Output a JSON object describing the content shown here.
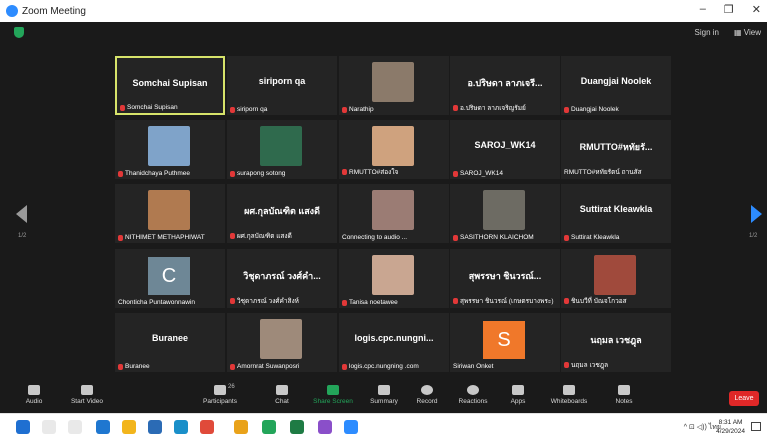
{
  "window": {
    "title": "Zoom Meeting",
    "minimize": "–",
    "maximize": "❐",
    "close": "✕"
  },
  "topbar": {
    "sign_in": "Sign in",
    "view": "View"
  },
  "pager": {
    "left": "1/2",
    "right": "1/2"
  },
  "tiles": [
    {
      "big": "Somchai Supisan",
      "cap": "Somchai Supisan",
      "muted": true,
      "active": true
    },
    {
      "big": "siriporn qa",
      "cap": "siriporn qa",
      "muted": true
    },
    {
      "big": "",
      "cap": "Narathip",
      "muted": true,
      "photo": "#8b7a6a"
    },
    {
      "big": "อ.ปริษดา ลาภเจรี...",
      "cap": "อ.ปริษดา ลาภเจริญรัมย์",
      "muted": true
    },
    {
      "big": "Duangjai Noolek",
      "cap": "Duangjai Noolek",
      "muted": true
    },
    {
      "big": "",
      "cap": "Thanidchaya Puthmee",
      "muted": true,
      "photo": "#7fa3c9"
    },
    {
      "big": "",
      "cap": "surapong sotong",
      "muted": true,
      "photo": "#2f6a4d"
    },
    {
      "big": "",
      "cap": "RMUTTO#ส่องใจ",
      "muted": true,
      "photo": "#cfa27e"
    },
    {
      "big": "SAROJ_WK14",
      "cap": "SAROJ_WK14",
      "muted": true
    },
    {
      "big": "RMUTTO#หทัยรั...",
      "cap": "RMUTTO#หทัยรัตน์ ถานสัส",
      "muted": false
    },
    {
      "big": "",
      "cap": "NITHIMET METHAPHIWAT",
      "muted": true,
      "photo": "#b07a50"
    },
    {
      "big": "ผศ.กุลบัณฑิต แสงดี",
      "cap": "ผศ.กุลบัณฑิต แสงดี",
      "muted": true
    },
    {
      "big": "",
      "cap": "Connecting to audio ...",
      "muted": false,
      "photo": "#9b7c74"
    },
    {
      "big": "",
      "cap": "SASITHORN KLAICHOM",
      "muted": true,
      "photo": "#6d6b63"
    },
    {
      "big": "Suttirat Kleawkla",
      "cap": "Suttirat Kleawkla",
      "muted": true
    },
    {
      "big": "",
      "cap": "Chonticha Puntawonnawin",
      "muted": false,
      "letter": "C",
      "letter_bg": "#6e8796"
    },
    {
      "big": "วิชุดาภรณ์ วงศ์คำ...",
      "cap": "วิชุดาภรณ์ วงศ์คำสิงห์",
      "muted": true
    },
    {
      "big": "",
      "cap": "Tanisa noetawee",
      "muted": true,
      "photo": "#c9a691"
    },
    {
      "big": "สุพรรษา ชินวรณ์...",
      "cap": "สุพรรษา ชินวรณ์ (เกษตรบางพระ)",
      "muted": true
    },
    {
      "big": "",
      "cap": "ชินบวีที่ บัณจโกวอส",
      "muted": true,
      "photo": "#a04a3c"
    },
    {
      "big": "Buranee",
      "cap": "Buranee",
      "muted": true
    },
    {
      "big": "",
      "cap": "Amornrat Suwanposri",
      "muted": true,
      "photo": "#9e8a7a"
    },
    {
      "big": "logis.cpc.nungni...",
      "cap": "logis.cpc.nungning .com",
      "muted": true
    },
    {
      "big": "",
      "cap": "Siriwan Onket",
      "muted": false,
      "letter": "S",
      "letter_bg": "#f0782a"
    },
    {
      "big": "นฤมล เวชฎุล",
      "cap": "นฤมล เวชฎุล",
      "muted": true
    }
  ],
  "toolbar": {
    "audio": "Audio",
    "video": "Start Video",
    "participants": "Participants",
    "participants_count": "26",
    "chat": "Chat",
    "share": "Share Screen",
    "summary": "Summary",
    "record": "Record",
    "reactions": "Reactions",
    "apps": "Apps",
    "whiteboards": "Whiteboards",
    "notes": "Notes",
    "leave": "Leave"
  },
  "taskbar": {
    "time": "8:31 AM",
    "date": "4/29/2024",
    "tray": "^ ⊡ ◁)) ไทย"
  },
  "colors": {
    "accent": "#2d8cff",
    "active_border": "#d6e36a",
    "leave": "#e02828",
    "share": "#23a55a"
  }
}
